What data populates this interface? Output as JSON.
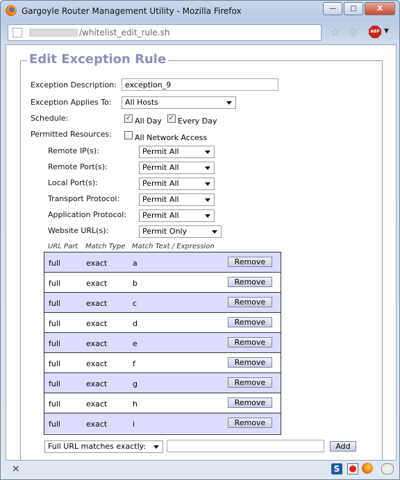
{
  "window": {
    "title": "Gargoyle Router Management Utility - Mozilla Firefox",
    "minimize": "—",
    "maximize": "□",
    "close": "X"
  },
  "nav": {
    "url": "/whitelist_edit_rule.sh",
    "abp_label": "ABP"
  },
  "page": {
    "legend": "Edit Exception Rule",
    "desc_label": "Exception Description:",
    "desc_value": "exception_9",
    "applies_label": "Exception Applies To:",
    "applies_value": "All Hosts",
    "schedule_label": "Schedule:",
    "all_day": "All Day",
    "every_day": "Every Day",
    "permitted_label": "Permitted Resources:",
    "all_network": "All Network Access",
    "resources": [
      {
        "label": "Remote IP(s):",
        "value": "Permit All"
      },
      {
        "label": "Remote Port(s):",
        "value": "Permit All"
      },
      {
        "label": "Local Port(s):",
        "value": "Permit All"
      },
      {
        "label": "Transport Protocol:",
        "value": "Permit All"
      },
      {
        "label": "Application Protocol:",
        "value": "Permit All"
      },
      {
        "label": "Website URL(s):",
        "value": "Permit Only"
      }
    ],
    "headers": [
      "URL Part",
      "Match Type",
      "Match Text / Expression"
    ],
    "rows": [
      {
        "part": "full",
        "type": "exact",
        "text": "a"
      },
      {
        "part": "full",
        "type": "exact",
        "text": "b"
      },
      {
        "part": "full",
        "type": "exact",
        "text": "c"
      },
      {
        "part": "full",
        "type": "exact",
        "text": "d"
      },
      {
        "part": "full",
        "type": "exact",
        "text": "e"
      },
      {
        "part": "full",
        "type": "exact",
        "text": "f"
      },
      {
        "part": "full",
        "type": "exact",
        "text": "g"
      },
      {
        "part": "full",
        "type": "exact",
        "text": "h"
      },
      {
        "part": "full",
        "type": "exact",
        "text": "i"
      }
    ],
    "remove_label": "Remove",
    "match_select": "Full URL matches exactly:",
    "match_input": "",
    "add_label": "Add"
  },
  "status": {
    "close": "×",
    "s_icon": "S"
  }
}
